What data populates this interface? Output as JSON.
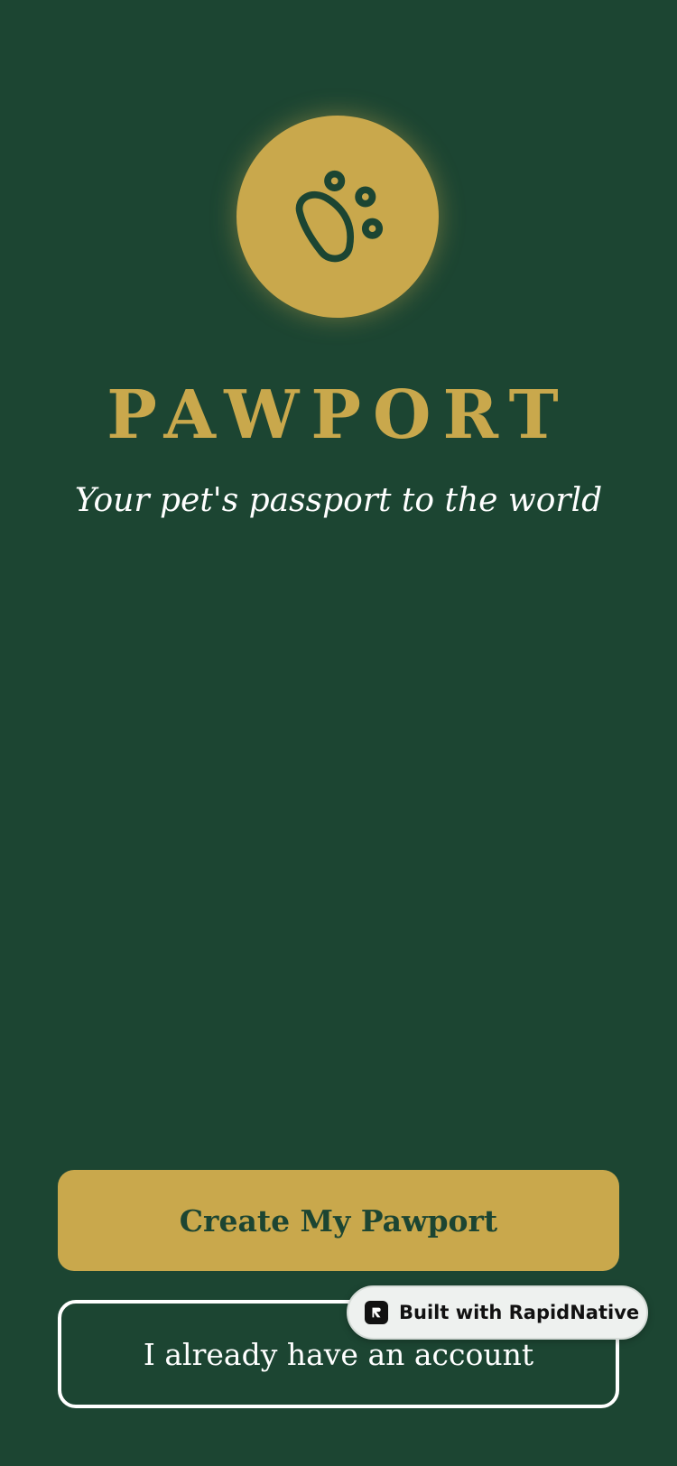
{
  "app": {
    "title": "PAWPORT",
    "tagline": "Your pet's passport to the world",
    "logo_icon": "paw-icon"
  },
  "actions": {
    "primary_label": "Create My Pawport",
    "secondary_label": "I already have an account"
  },
  "badge": {
    "icon": "rapidnative-logo-icon",
    "text": "Built with RapidNative"
  },
  "colors": {
    "background": "#1c4532",
    "accent": "#c9a84c",
    "text_light": "#ffffff",
    "badge_bg": "#eef1ef"
  }
}
